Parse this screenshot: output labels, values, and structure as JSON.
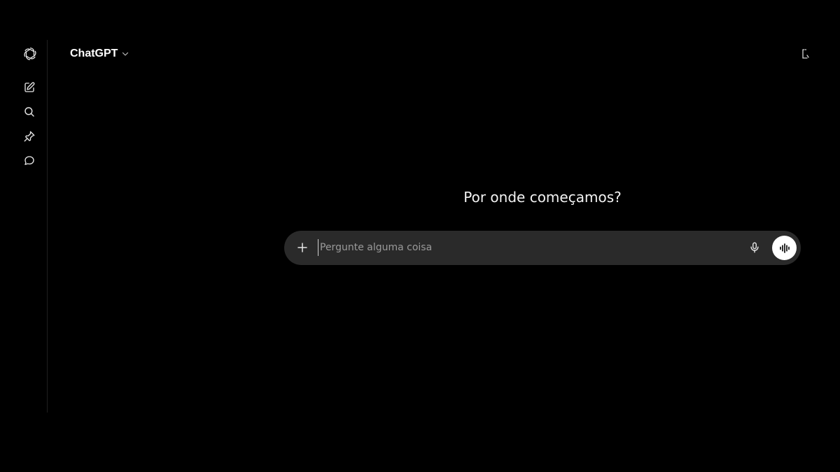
{
  "app": {
    "model_name": "ChatGPT"
  },
  "sidebar": {
    "items": [
      {
        "icon": "openai-logo-icon"
      },
      {
        "icon": "new-chat-icon"
      },
      {
        "icon": "search-icon"
      },
      {
        "icon": "pin-icon"
      },
      {
        "icon": "chat-bubble-icon"
      }
    ]
  },
  "main": {
    "headline": "Por onde começamos?"
  },
  "composer": {
    "placeholder": "Pergunte alguma coisa",
    "value": ""
  },
  "colors": {
    "background": "#000000",
    "composer_bg": "#2a2a2a",
    "voice_button_bg": "#ffffff"
  }
}
